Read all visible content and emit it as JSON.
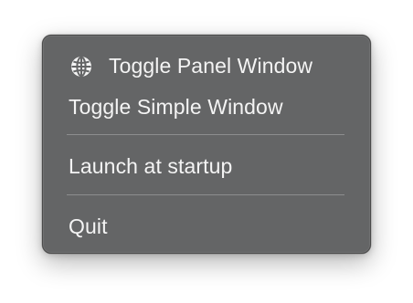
{
  "menu": {
    "items": [
      {
        "label": "Toggle Panel Window",
        "icon": "globe-icon"
      },
      {
        "label": "Toggle Simple Window"
      },
      {
        "label": "Launch at startup"
      },
      {
        "label": "Quit"
      }
    ]
  },
  "colors": {
    "menu_background": "#646566",
    "text": "#f4f4f4",
    "separator": "#8d8e8f"
  }
}
